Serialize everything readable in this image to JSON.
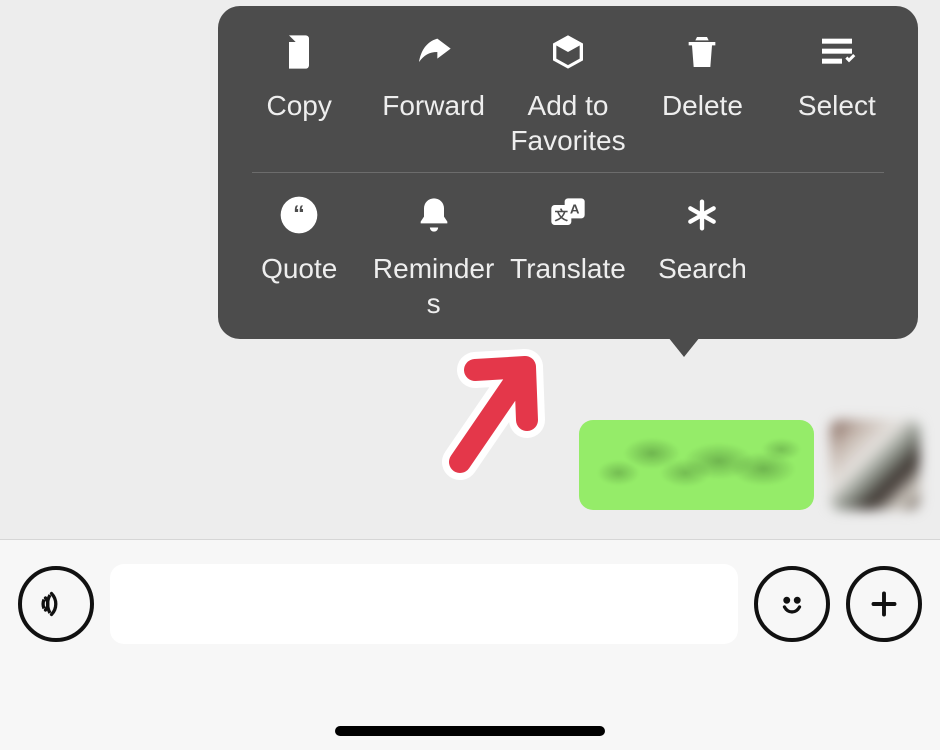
{
  "menu": {
    "row1": [
      {
        "label": "Copy",
        "icon": "copy-icon"
      },
      {
        "label": "Forward",
        "icon": "forward-icon"
      },
      {
        "label": "Add to Favorites",
        "icon": "favorite-icon"
      },
      {
        "label": "Delete",
        "icon": "delete-icon"
      },
      {
        "label": "Select",
        "icon": "select-icon"
      }
    ],
    "row2": [
      {
        "label": "Quote",
        "icon": "quote-icon"
      },
      {
        "label": "Reminders",
        "icon": "reminder-icon"
      },
      {
        "label": "Translate",
        "icon": "translate-icon"
      },
      {
        "label": "Search",
        "icon": "search-icon"
      }
    ]
  },
  "annotation": {
    "target": "translate",
    "color": "#e4374a"
  },
  "message": {
    "direction": "outgoing",
    "text_redacted": true
  },
  "inputBar": {
    "value": "",
    "placeholder": ""
  },
  "colors": {
    "menuBg": "#4c4c4c",
    "chatBg": "#ededed",
    "bubbleGreen": "#95ec69"
  }
}
